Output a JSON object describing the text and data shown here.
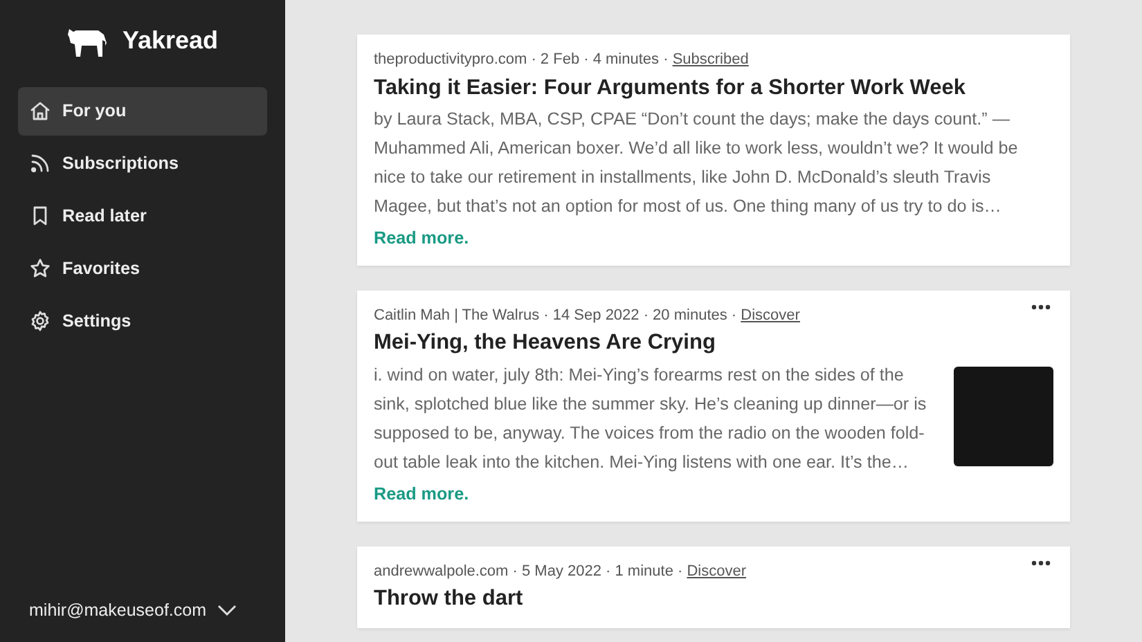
{
  "sidebar": {
    "brand": "Yakread",
    "items": [
      {
        "label": "For you",
        "selected": true
      },
      {
        "label": "Subscriptions",
        "selected": false
      },
      {
        "label": "Read later",
        "selected": false
      },
      {
        "label": "Favorites",
        "selected": false
      },
      {
        "label": "Settings",
        "selected": false
      }
    ],
    "account": "mihir@makeuseof.com"
  },
  "feed": [
    {
      "meta": "theproductivitypro.com · 2 Feb · 4 minutes ·",
      "tag": "Subscribed",
      "menu": false,
      "thumbnail": false,
      "title": "Taking it Easier: Four Arguments for a Shorter Work Week",
      "excerpt": "by Laura Stack, MBA, CSP, CPAE “Don’t count the days; make the days count.” — Muhammed Ali, American boxer. We’d all like to work less, wouldn’t we? It would be nice to take our retirement in installments, like John D. McDonald’s sleuth Travis Magee, but that’s not an option for most of us. One thing many of us try to do is…",
      "more": "Read more."
    },
    {
      "meta": "Caitlin Mah | The Walrus · 14 Sep 2022 · 20 minutes ·",
      "tag": "Discover",
      "menu": true,
      "thumbnail": true,
      "title": "Mei-Ying, the Heavens Are Crying",
      "excerpt": "i. wind on water, july 8th: Mei-Ying’s forearms rest on the sides of the sink, splotched blue like the summer sky. He’s cleaning up dinner—or is supposed to be, anyway. The voices from the radio on the wooden fold-out table leak into the kitchen. Mei-Ying listens with one ear. It’s the…",
      "more": "Read more."
    },
    {
      "meta": "andrewwalpole.com · 5 May 2022 · 1 minute ·",
      "tag": "Discover",
      "menu": true,
      "thumbnail": false,
      "title": "Throw the dart"
    }
  ]
}
